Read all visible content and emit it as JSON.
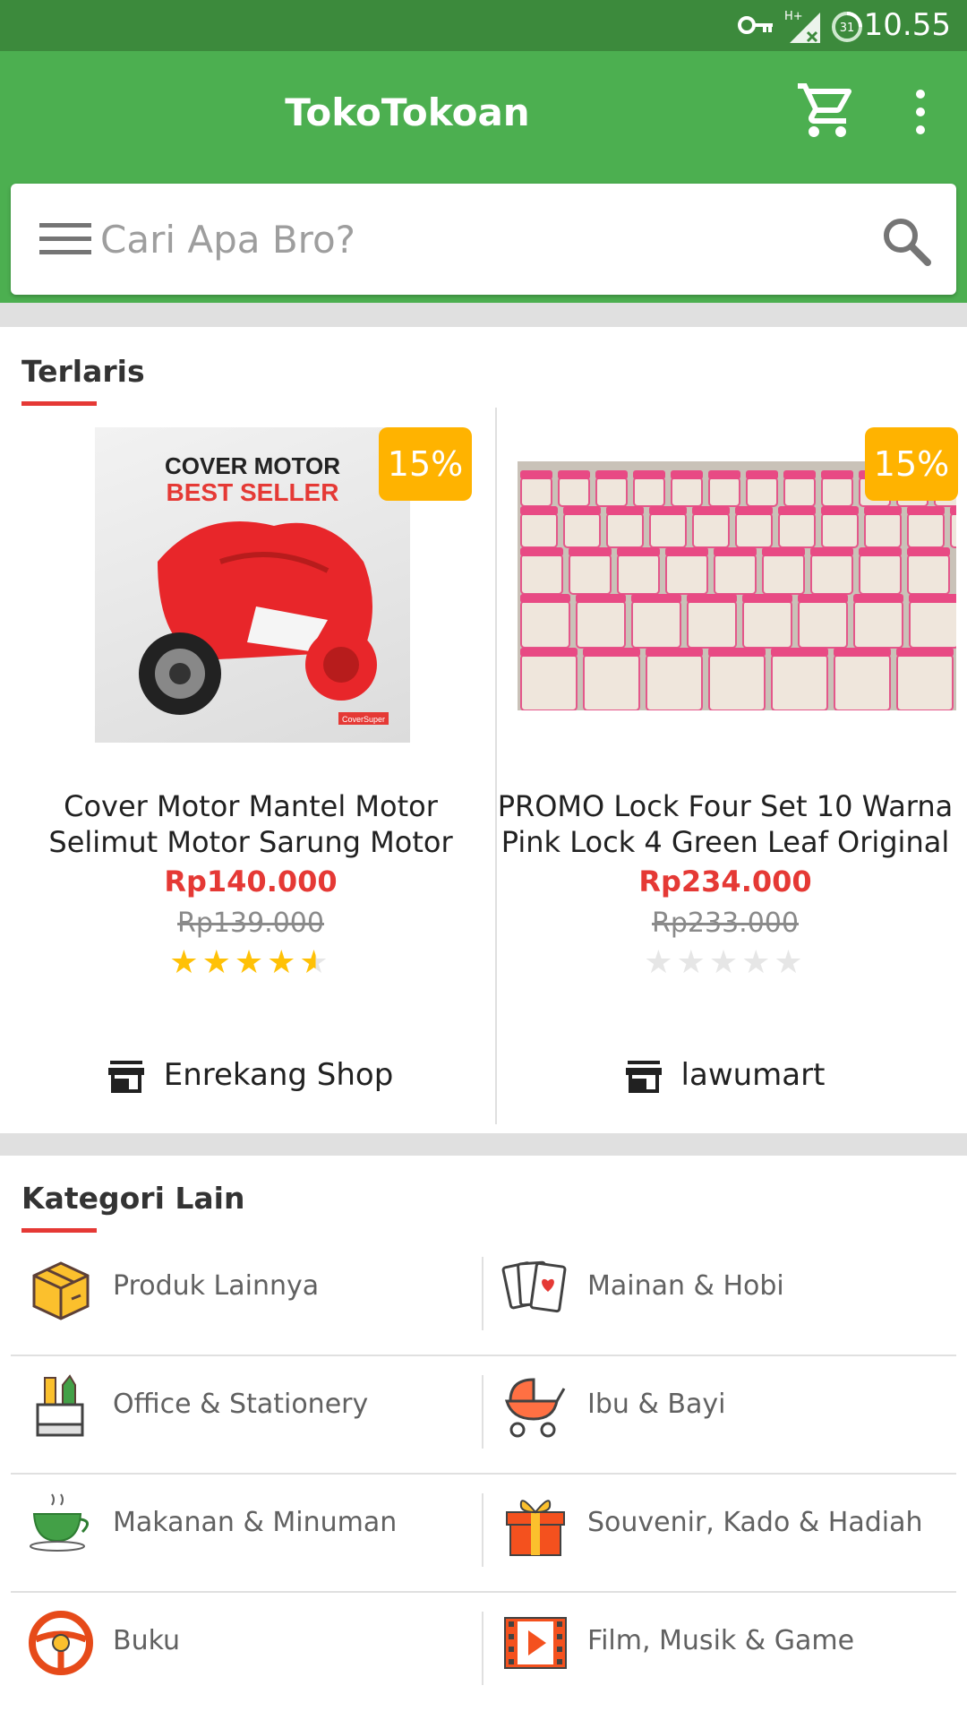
{
  "status_bar": {
    "time": "10.55",
    "network": "H+",
    "notification_count": "31",
    "icons": [
      "key-icon",
      "signal-icon",
      "notification-icon"
    ]
  },
  "app_bar": {
    "title": "TokoTokoan",
    "icons": [
      "cart-icon",
      "more-vert-icon"
    ]
  },
  "search": {
    "placeholder": "Cari Apa Bro?",
    "icons": [
      "menu-icon",
      "search-icon"
    ]
  },
  "bestseller": {
    "title": "Terlaris",
    "products": [
      {
        "discount": "15%",
        "image_text_1": "COVER MOTOR",
        "image_text_2": "BEST SELLER",
        "image_text_3": "CoverSuper",
        "name_line1": "Cover Motor Mantel Motor",
        "name_line2": "Selimut Motor Sarung Motor",
        "price": "Rp140.000",
        "old_price": "Rp139.000",
        "rating": 4.5,
        "shop": "Enrekang Shop"
      },
      {
        "discount": "15%",
        "name_line1": "PROMO Lock Four Set 10 Warna",
        "name_line2": "Pink Lock 4 Green Leaf Original",
        "price": "Rp234.000",
        "old_price": "Rp233.000",
        "rating": 0,
        "shop": "lawumart"
      }
    ]
  },
  "categories": {
    "title": "Kategori Lain",
    "items": [
      {
        "label": "Produk Lainnya",
        "icon": "box-icon"
      },
      {
        "label": "Mainan & Hobi",
        "icon": "playing-cards-icon"
      },
      {
        "label": "Office & Stationery",
        "icon": "stationery-icon"
      },
      {
        "label": "Ibu & Bayi",
        "icon": "baby-stroller-icon"
      },
      {
        "label": "Makanan & Minuman",
        "icon": "teacup-icon"
      },
      {
        "label": "Souvenir, Kado & Hadiah",
        "icon": "gift-icon"
      },
      {
        "label": "Buku",
        "icon": "steering-wheel-icon"
      },
      {
        "label": "Film, Musik & Game",
        "icon": "film-icon"
      }
    ]
  },
  "colors": {
    "primary": "#4caf50",
    "status_bar": "#3c8a3c",
    "accent_red": "#e53935",
    "badge": "#ffb300",
    "star": "#ffc107"
  }
}
